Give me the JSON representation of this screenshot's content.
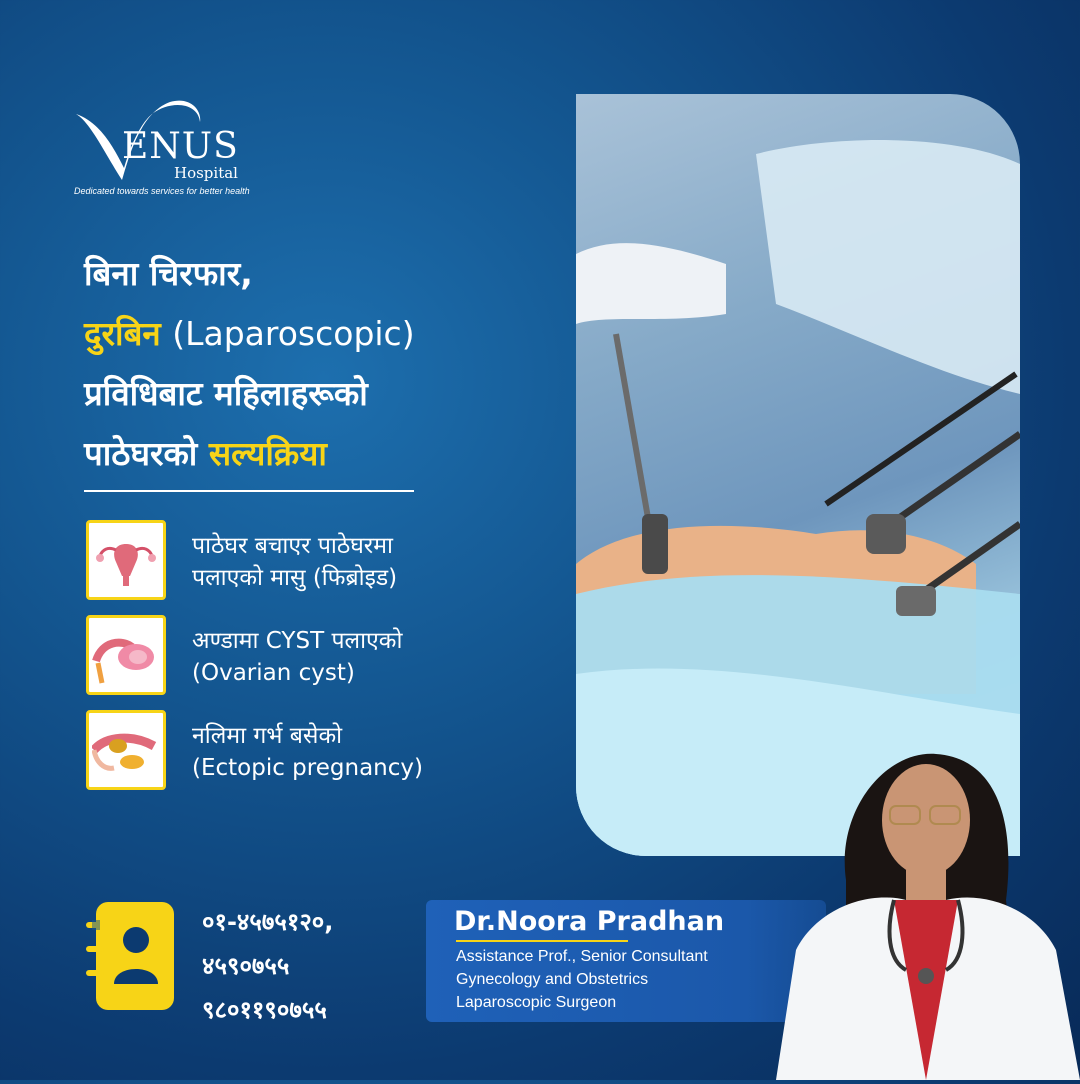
{
  "brand": {
    "logo_word": "ENUS",
    "logo_sub": "Hospital",
    "tagline": "Dedicated towards services for better health"
  },
  "headline": {
    "line1": "बिना चिरफार,",
    "line2_highlight": "दुरबिन",
    "line2_rest": "(Laparoscopic)",
    "line3": "प्रविधिबाट महिलाहरूको",
    "line4_plain": "पाठेघरको",
    "line4_highlight": "सल्यक्रिया"
  },
  "services": [
    {
      "icon": "uterus-icon",
      "line1": "पाठेघर बचाएर पाठेघरमा",
      "line2": "पलाएको मासु (फिब्रोइड)"
    },
    {
      "icon": "ovary-icon",
      "line1": "अण्डामा CYST पलाएको",
      "line2": "(Ovarian cyst)"
    },
    {
      "icon": "fallopian-tube-icon",
      "line1": "नलिमा गर्भ बसेको",
      "line2": "(Ectopic pregnancy)"
    }
  ],
  "contact": {
    "icon": "contact-book-icon",
    "phones": [
      "०१-४५७५१२०,",
      "४५९०७५५",
      "९८०११९०७५५"
    ]
  },
  "doctor": {
    "name": "Dr.Noora Pradhan",
    "titles": [
      "Assistance Prof., Senior Consultant",
      "Gynecology and Obstetrics",
      "Laparoscopic Surgeon"
    ]
  },
  "colors": {
    "background": "#13558f",
    "accent": "#f7d417",
    "doctor_box": "#1b58aa"
  }
}
